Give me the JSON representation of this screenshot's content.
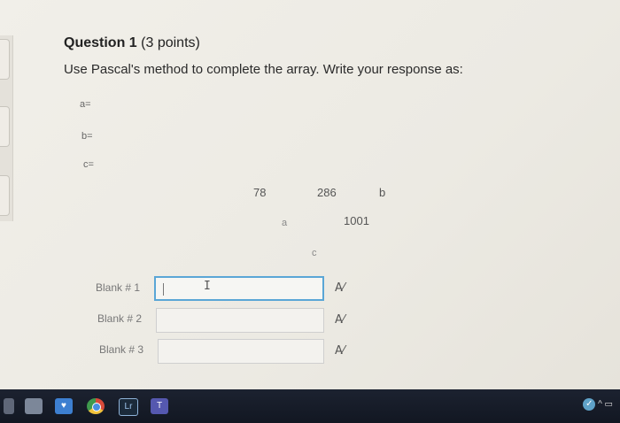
{
  "question": {
    "number_label": "Question 1",
    "points_label": "(3 points)",
    "instruction": "Use Pascal's method to complete the array. Write your response as:"
  },
  "variables": [
    "a=",
    "b=",
    "c="
  ],
  "triangle": {
    "row1": [
      "78",
      "286",
      "b"
    ],
    "row2": [
      "a",
      "1001"
    ],
    "row3": [
      "c"
    ]
  },
  "blanks": [
    {
      "label": "Blank # 1",
      "value": "",
      "focused": true
    },
    {
      "label": "Blank # 2",
      "value": "",
      "focused": false
    },
    {
      "label": "Blank # 3",
      "value": "",
      "focused": false
    }
  ],
  "icons": {
    "spellcheck": "spellcheck-icon",
    "taskbar": [
      "windows-icon",
      "store-icon",
      "mail-icon",
      "chrome-icon",
      "lightroom-icon",
      "teams-icon"
    ],
    "tray": [
      "network-check-icon",
      "chevron-up-icon",
      "display-icon"
    ]
  },
  "taskbar_labels": {
    "lightroom": "Lr",
    "teams": "T"
  },
  "colors": {
    "focus_border": "#5aa6d6",
    "screen_bg": "#eeece6"
  }
}
